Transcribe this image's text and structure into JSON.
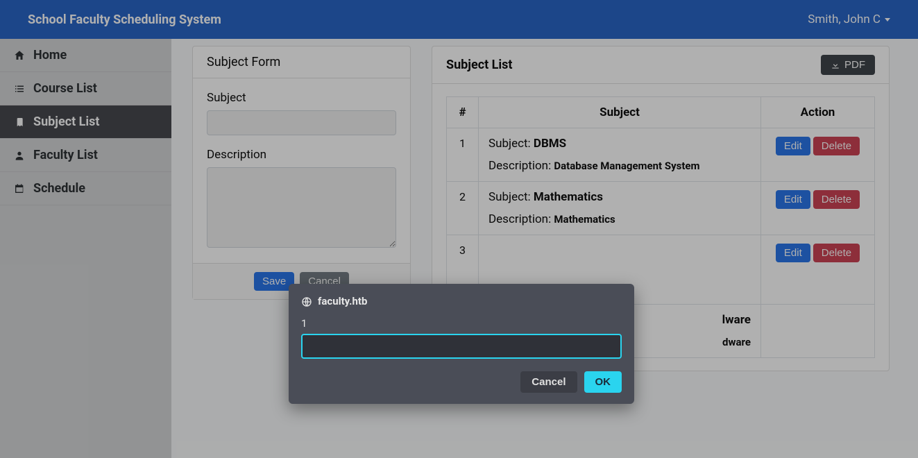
{
  "navbar": {
    "brand": "School Faculty Scheduling System",
    "user": "Smith, John C"
  },
  "sidebar": {
    "items": [
      {
        "label": "Home",
        "icon": "home-icon",
        "active": false
      },
      {
        "label": "Course List",
        "icon": "list-icon",
        "active": false
      },
      {
        "label": "Subject List",
        "icon": "book-icon",
        "active": true
      },
      {
        "label": "Faculty List",
        "icon": "user-icon",
        "active": false
      },
      {
        "label": "Schedule",
        "icon": "calendar-icon",
        "active": false
      }
    ]
  },
  "form": {
    "title": "Subject Form",
    "subject_label": "Subject",
    "subject_value": "",
    "description_label": "Description",
    "description_value": "",
    "save_label": "Save",
    "cancel_label": "Cancel"
  },
  "list": {
    "title": "Subject List",
    "pdf_label": "PDF",
    "headers": {
      "idx": "#",
      "subject": "Subject",
      "action": "Action"
    },
    "subject_prefix": "Subject: ",
    "description_prefix": "Description: ",
    "edit_label": "Edit",
    "delete_label": "Delete",
    "rows": [
      {
        "idx": "1",
        "name": "DBMS",
        "desc": "Database Management System"
      },
      {
        "idx": "2",
        "name": "Mathematics",
        "desc": "Mathematics"
      },
      {
        "idx": "3",
        "name": "",
        "desc": ""
      },
      {
        "idx": "",
        "name": "…ware",
        "desc": "…dware",
        "partial_name_suffix": "lware",
        "partial_desc_suffix": "dware"
      }
    ]
  },
  "dialog": {
    "host": "faculty.htb",
    "prompt_label": "1",
    "input_value": "",
    "cancel_label": "Cancel",
    "ok_label": "OK"
  },
  "colors": {
    "navbar_bg": "#1d5dc4",
    "primary_btn": "#1e6ee8",
    "danger_btn": "#c9384a",
    "dialog_bg": "#4a4d57",
    "dialog_accent": "#2ad4ef"
  }
}
